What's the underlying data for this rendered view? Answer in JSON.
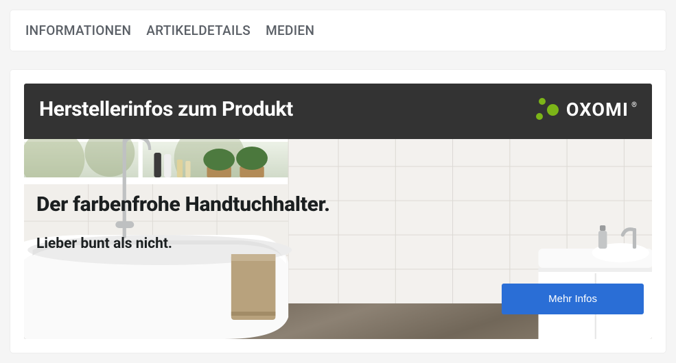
{
  "tabs": [
    {
      "label": "INFORMATIONEN"
    },
    {
      "label": "ARTIKELDETAILS"
    },
    {
      "label": "MEDIEN"
    }
  ],
  "hero": {
    "title": "Herstellerinfos zum Produkt",
    "brand": "OXOMI",
    "headline": "Der farbenfrohe Handtuchhalter.",
    "subhead": "Lieber bunt als nicht.",
    "cta": "Mehr Infos"
  }
}
